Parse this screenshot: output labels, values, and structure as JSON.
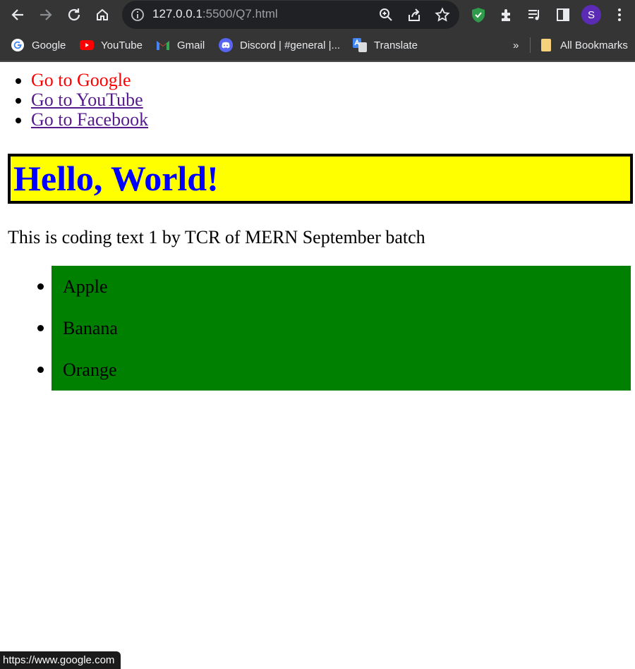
{
  "browser": {
    "url_host": "127.0.0.1",
    "url_path": ":5500/Q7.html",
    "profile_initial": "S",
    "bookmarks": [
      {
        "label": "Google",
        "icon": "google-icon"
      },
      {
        "label": "YouTube",
        "icon": "youtube-icon"
      },
      {
        "label": "Gmail",
        "icon": "gmail-icon"
      },
      {
        "label": "Discord | #general |...",
        "icon": "discord-icon"
      },
      {
        "label": "Translate",
        "icon": "translate-icon"
      }
    ],
    "more_bookmarks": "»",
    "all_bookmarks": "All Bookmarks",
    "status_url": "https://www.google.com"
  },
  "page": {
    "links": [
      {
        "label": "Go to Google",
        "color": "#ff0000"
      },
      {
        "label": "Go to YouTube",
        "color": "#551a8b"
      },
      {
        "label": "Go to Facebook",
        "color": "#551a8b"
      }
    ],
    "heading": "Hello, World!",
    "heading_color": "#0000ff",
    "heading_bg": "#ffff00",
    "paragraph": "This is coding text 1 by TCR of MERN September batch",
    "fruits": [
      "Apple",
      "Banana",
      "Orange"
    ],
    "fruits_bg": "#008000"
  }
}
